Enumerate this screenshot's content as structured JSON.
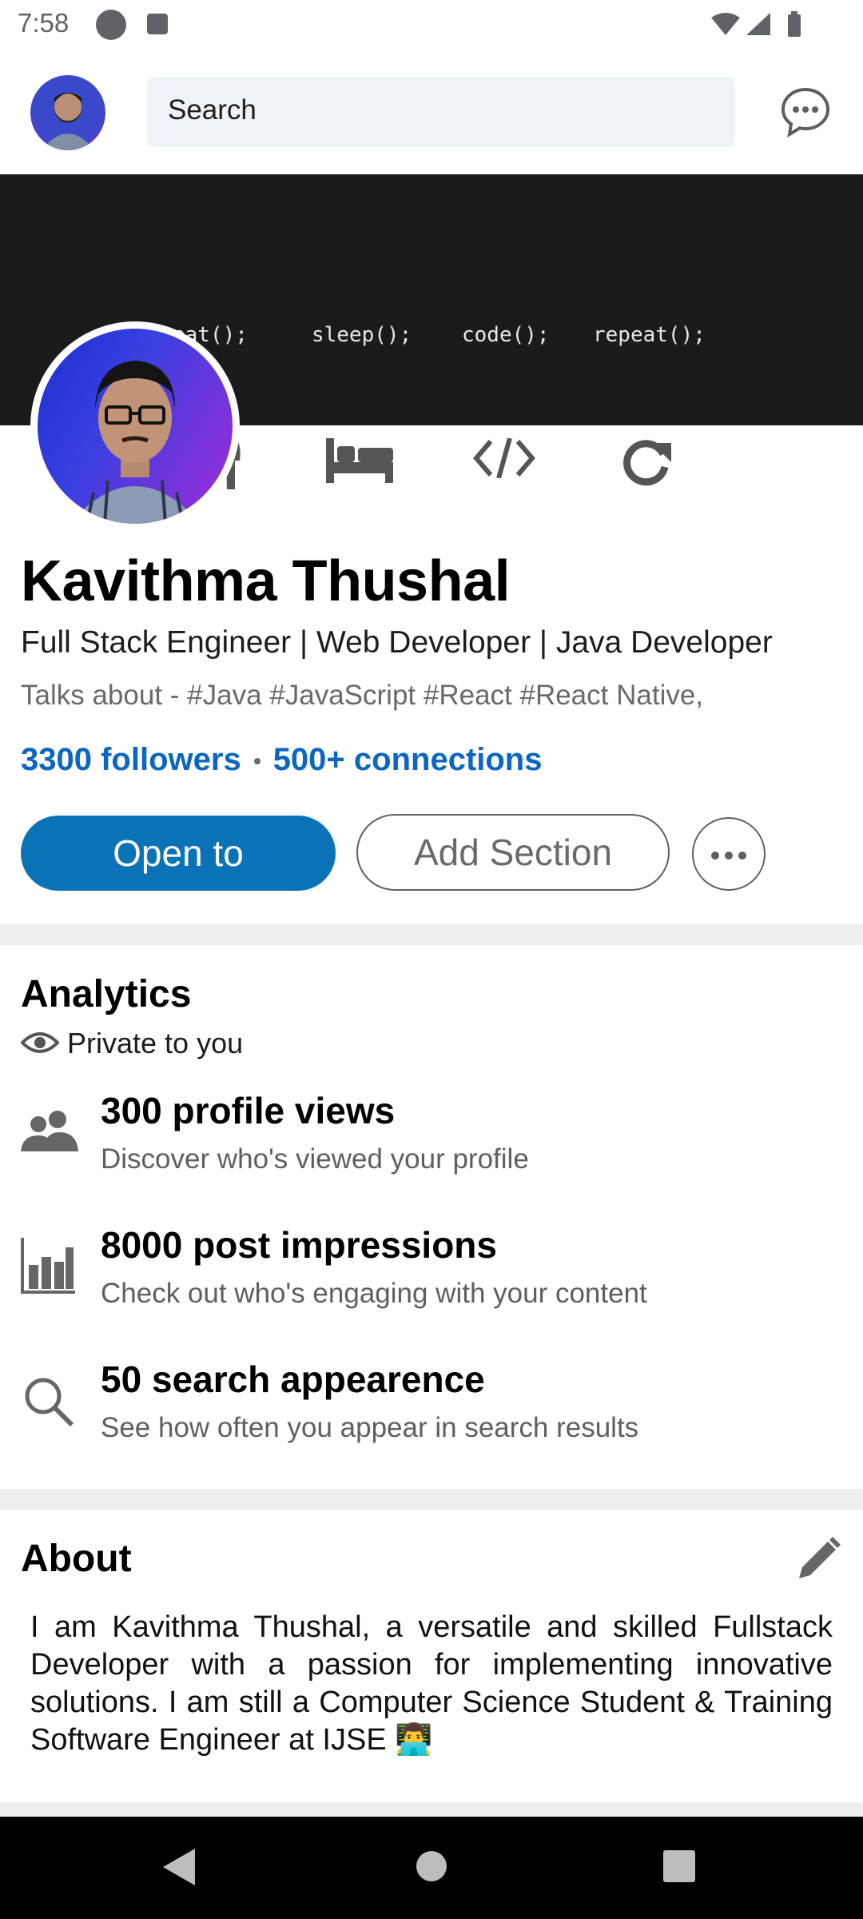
{
  "status_bar": {
    "time": "7:58"
  },
  "topbar": {
    "search_placeholder": "Search"
  },
  "cover": {
    "words": [
      "eat();",
      "sleep();",
      "code();",
      "repeat();"
    ]
  },
  "profile": {
    "name": "Kavithma Thushal",
    "headline": "Full Stack Engineer | Web Developer | Java Developer",
    "talks_about": "Talks about - #Java #JavaScript #React #React Native,",
    "followers": "3300 followers",
    "connections": "500+ connections",
    "open_to_label": "Open to",
    "add_section_label": "Add Section"
  },
  "analytics": {
    "title": "Analytics",
    "privacy": "Private to you",
    "items": [
      {
        "title": "300 profile views",
        "subtitle": "Discover who's viewed your profile",
        "icon": "people-icon"
      },
      {
        "title": "8000 post impressions",
        "subtitle": "Check out who's engaging with your content",
        "icon": "bar-chart-icon"
      },
      {
        "title": "50 search appearence",
        "subtitle": "See how often you appear in search results",
        "icon": "search-icon"
      }
    ]
  },
  "about": {
    "title": "About",
    "text": "I am Kavithma Thushal, a versatile and skilled Fullstack Developer with a passion for implementing innovative solutions. I am still a Computer Science Student & Training Software Engineer at IJSE 👨‍💻"
  },
  "colors": {
    "link": "#0a66c2",
    "primary_button": "#0a73b7",
    "cover_bg": "#1b1b1b"
  }
}
